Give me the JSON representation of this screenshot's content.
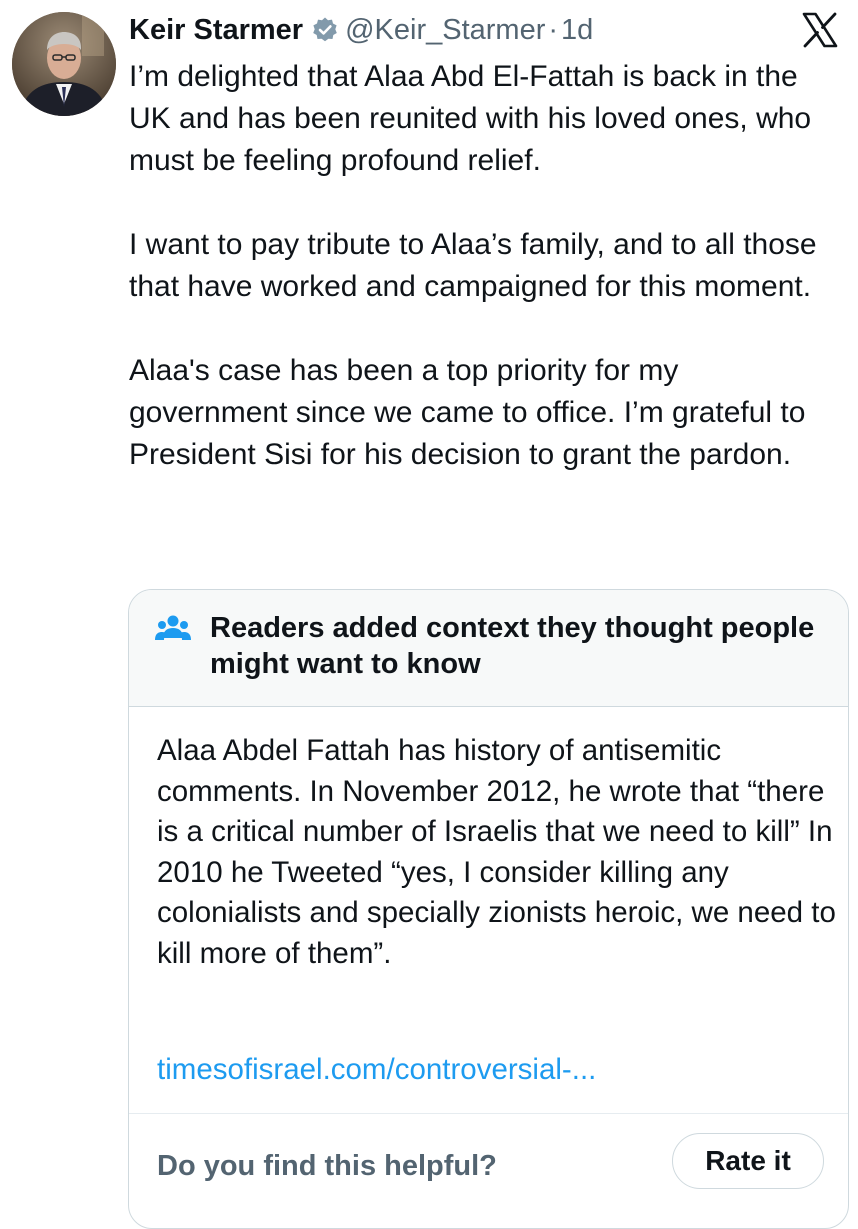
{
  "author": {
    "name": "Keir Starmer",
    "handle": "@Keir_Starmer",
    "separator": "·",
    "time": "1d",
    "verified_color": "#829aab"
  },
  "tweet": {
    "paragraphs": [
      "I’m delighted that Alaa Abd El-Fattah is back in the UK and has been reunited with his loved ones, who must be feeling profound relief.",
      "I want to pay tribute to Alaa’s family, and to all those that have worked and campaigned for this moment.",
      "Alaa's case has been a top priority for my government since we came to office. I’m grateful to President Sisi for his decision to grant the pardon."
    ]
  },
  "community_note": {
    "title": "Readers added context they thought people might want to know",
    "body": "Alaa Abdel Fattah has history of antisemitic comments. In November 2012, he wrote that “there is a critical number of Israelis that we need to kill” In 2010 he Tweeted “yes, I consider killing any colonialists and specially zionists heroic, we need to kill more of them”.",
    "link": "timesofisrael.com/controversial-...",
    "helpful_question": "Do you find this helpful?",
    "rate_label": "Rate it",
    "icon": "people-group-icon",
    "icon_color": "#1d9bf0",
    "link_color": "#1d9bf0"
  },
  "icons": {
    "platform": "x-logo-icon",
    "verified": "verified-badge-icon"
  }
}
